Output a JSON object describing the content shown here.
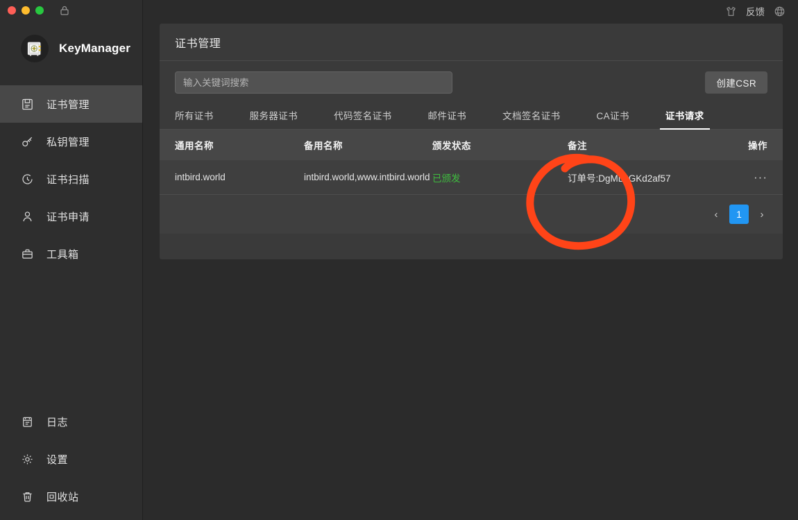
{
  "window": {
    "traffic_lights": [
      "close",
      "minimize",
      "zoom"
    ],
    "lock_icon": "lock-icon",
    "colors": {
      "red": "#ff5f57",
      "yellow": "#febc2e",
      "green": "#28c840"
    }
  },
  "sidebar": {
    "brand": {
      "name": "KeyManager",
      "logo_icon": "safe-vault-icon"
    },
    "items": [
      {
        "label": "证书管理",
        "icon": "certificate-book-icon",
        "active": true
      },
      {
        "label": "私钥管理",
        "icon": "key-icon",
        "active": false
      },
      {
        "label": "证书扫描",
        "icon": "scan-clock-icon",
        "active": false
      },
      {
        "label": "证书申请",
        "icon": "person-icon",
        "active": false
      },
      {
        "label": "工具箱",
        "icon": "toolbox-icon",
        "active": false
      }
    ],
    "bottom_items": [
      {
        "label": "日志",
        "icon": "log-note-icon"
      },
      {
        "label": "设置",
        "icon": "gear-icon"
      },
      {
        "label": "回收站",
        "icon": "trash-icon"
      }
    ]
  },
  "topbar": {
    "theme_icon": "tshirt-icon",
    "feedback_label": "反馈",
    "language_icon": "globe-icon"
  },
  "main": {
    "page_title": "证书管理",
    "search": {
      "value": "",
      "placeholder": "输入关键词搜索"
    },
    "create_csr_label": "创建CSR",
    "tabs": [
      {
        "label": "所有证书",
        "active": false
      },
      {
        "label": "服务器证书",
        "active": false
      },
      {
        "label": "代码签名证书",
        "active": false
      },
      {
        "label": "邮件证书",
        "active": false
      },
      {
        "label": "文档签名证书",
        "active": false
      },
      {
        "label": "CA证书",
        "active": false
      },
      {
        "label": "证书请求",
        "active": true
      }
    ],
    "table": {
      "columns": {
        "common_name": "通用名称",
        "alt_name": "备用名称",
        "status": "颁发状态",
        "note": "备注",
        "action": "操作"
      },
      "rows": [
        {
          "common_name": "intbird.world",
          "alt_name": "intbird.world,www.intbird.world",
          "status": "已颁发",
          "status_color": "#3fbd3f",
          "note": "订单号:DgML6GKd2af57",
          "action": "···"
        }
      ]
    },
    "pagination": {
      "prev": "‹",
      "current": "1",
      "next": "›",
      "active_color": "#2196f3"
    }
  },
  "annotation": {
    "type": "hand-drawn-circle",
    "color": "#ff4418",
    "target": "颁发状态 / 已颁发"
  }
}
